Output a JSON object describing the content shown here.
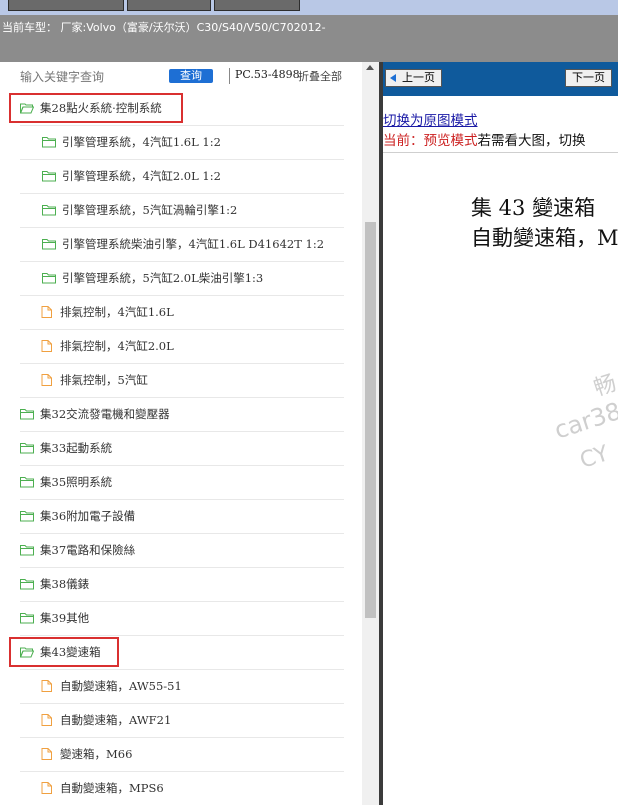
{
  "header": {
    "vehicle_label": "当前车型：",
    "vehicle_value": "厂家:Volvo（富豪/沃尔沃）C30/S40/V50/C702012-"
  },
  "sidebar": {
    "search_placeholder": "输入关键字查询",
    "search_button": "查询",
    "pc_code": "PC.53-4898",
    "collapse_all": "折叠全部",
    "tree": [
      {
        "label": "集28點火系統·控制系統",
        "level": 1,
        "type": "folder-open",
        "highlight": true
      },
      {
        "label": "引擎管理系統，4汽缸1.6L 1:2",
        "level": 2,
        "type": "folder"
      },
      {
        "label": "引擎管理系統，4汽缸2.0L 1:2",
        "level": 2,
        "type": "folder"
      },
      {
        "label": "引擎管理系統，5汽缸渦輪引擎1:2",
        "level": 2,
        "type": "folder"
      },
      {
        "label": "引擎管理系統柴油引擎，4汽缸1.6L D41642T 1:2",
        "level": 2,
        "type": "folder"
      },
      {
        "label": "引擎管理系統，5汽缸2.0L柴油引擎1:3",
        "level": 2,
        "type": "folder"
      },
      {
        "label": "排氣控制，4汽缸1.6L",
        "level": 2,
        "type": "file"
      },
      {
        "label": "排氣控制，4汽缸2.0L",
        "level": 2,
        "type": "file"
      },
      {
        "label": "排氣控制，5汽缸",
        "level": 2,
        "type": "file"
      },
      {
        "label": "集32交流發電機和變壓器",
        "level": 1,
        "type": "folder"
      },
      {
        "label": "集33起動系統",
        "level": 1,
        "type": "folder"
      },
      {
        "label": "集35照明系統",
        "level": 1,
        "type": "folder"
      },
      {
        "label": "集36附加電子設備",
        "level": 1,
        "type": "folder"
      },
      {
        "label": "集37電路和保險絲",
        "level": 1,
        "type": "folder"
      },
      {
        "label": "集38儀錶",
        "level": 1,
        "type": "folder"
      },
      {
        "label": "集39其他",
        "level": 1,
        "type": "folder"
      },
      {
        "label": "集43變速箱",
        "level": 1,
        "type": "folder-open",
        "highlight": true
      },
      {
        "label": "自動變速箱，AW55-51",
        "level": 2,
        "type": "file"
      },
      {
        "label": "自動變速箱，AWF21",
        "level": 2,
        "type": "file"
      },
      {
        "label": "變速箱，M66",
        "level": 2,
        "type": "file"
      },
      {
        "label": "自動變速箱，MPS6",
        "level": 2,
        "type": "file"
      }
    ]
  },
  "viewer": {
    "prev_button": "上一页",
    "next_button": "下一页",
    "switch_link": "切换为原图模式",
    "mode_prefix": "当前：",
    "mode_name": "预览模式",
    "mode_hint": "若需看大图，切换",
    "doc_title_line1": "集 43 變速箱",
    "doc_title_line2": "自動變速箱，M",
    "watermark_1": "畅",
    "watermark_2": "car38",
    "watermark_3": "CY"
  },
  "colors": {
    "accent_blue": "#1e6fd4",
    "nav_blue": "#0f5a9c",
    "highlight_red": "#d93030",
    "folder_green": "#4caf50",
    "file_orange": "#f0a040"
  }
}
